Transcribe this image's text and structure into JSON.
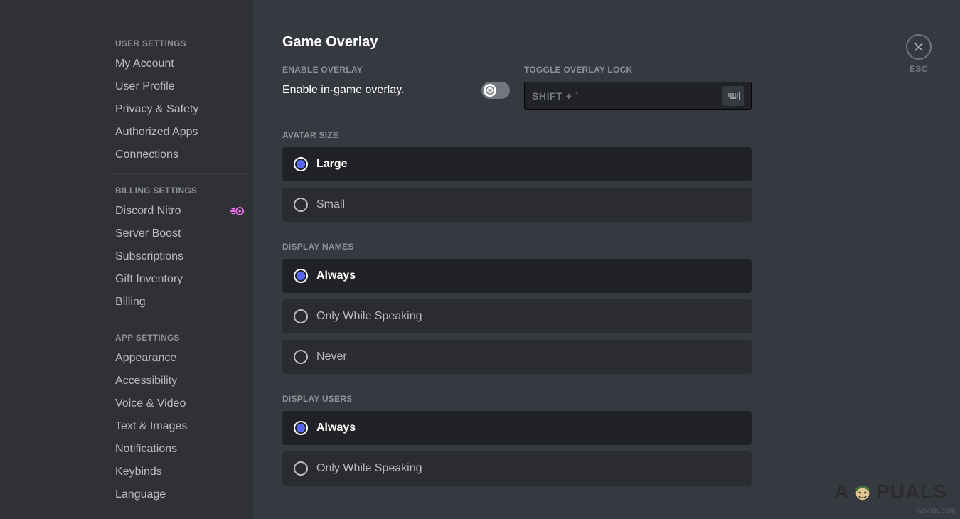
{
  "sidebar": {
    "sections": [
      {
        "header": "USER SETTINGS",
        "items": [
          {
            "label": "My Account",
            "name": "sidebar-item-my-account"
          },
          {
            "label": "User Profile",
            "name": "sidebar-item-user-profile"
          },
          {
            "label": "Privacy & Safety",
            "name": "sidebar-item-privacy-safety"
          },
          {
            "label": "Authorized Apps",
            "name": "sidebar-item-authorized-apps"
          },
          {
            "label": "Connections",
            "name": "sidebar-item-connections"
          }
        ]
      },
      {
        "header": "BILLING SETTINGS",
        "items": [
          {
            "label": "Discord Nitro",
            "name": "sidebar-item-discord-nitro",
            "icon": "nitro"
          },
          {
            "label": "Server Boost",
            "name": "sidebar-item-server-boost"
          },
          {
            "label": "Subscriptions",
            "name": "sidebar-item-subscriptions"
          },
          {
            "label": "Gift Inventory",
            "name": "sidebar-item-gift-inventory"
          },
          {
            "label": "Billing",
            "name": "sidebar-item-billing"
          }
        ]
      },
      {
        "header": "APP SETTINGS",
        "items": [
          {
            "label": "Appearance",
            "name": "sidebar-item-appearance"
          },
          {
            "label": "Accessibility",
            "name": "sidebar-item-accessibility"
          },
          {
            "label": "Voice & Video",
            "name": "sidebar-item-voice-video"
          },
          {
            "label": "Text & Images",
            "name": "sidebar-item-text-images"
          },
          {
            "label": "Notifications",
            "name": "sidebar-item-notifications"
          },
          {
            "label": "Keybinds",
            "name": "sidebar-item-keybinds"
          },
          {
            "label": "Language",
            "name": "sidebar-item-language"
          }
        ]
      }
    ]
  },
  "main": {
    "title": "Game Overlay",
    "enable": {
      "header": "ENABLE OVERLAY",
      "text": "Enable in-game overlay.",
      "on": false
    },
    "lock": {
      "header": "TOGGLE OVERLAY LOCK",
      "value": "SHIFT + `"
    },
    "groups": [
      {
        "header": "AVATAR SIZE",
        "name": "group-avatar-size",
        "options": [
          {
            "label": "Large",
            "selected": true
          },
          {
            "label": "Small",
            "selected": false
          }
        ]
      },
      {
        "header": "DISPLAY NAMES",
        "name": "group-display-names",
        "options": [
          {
            "label": "Always",
            "selected": true
          },
          {
            "label": "Only While Speaking",
            "selected": false
          },
          {
            "label": "Never",
            "selected": false
          }
        ]
      },
      {
        "header": "DISPLAY USERS",
        "name": "group-display-users",
        "options": [
          {
            "label": "Always",
            "selected": true
          },
          {
            "label": "Only While Speaking",
            "selected": false
          }
        ]
      }
    ],
    "close_label": "ESC"
  },
  "watermark": "wsxdn.com",
  "brand": {
    "pre": "A",
    "post": "PUALS"
  },
  "colors": {
    "accent": "#5865f2",
    "nitro": "#ff73fa"
  }
}
